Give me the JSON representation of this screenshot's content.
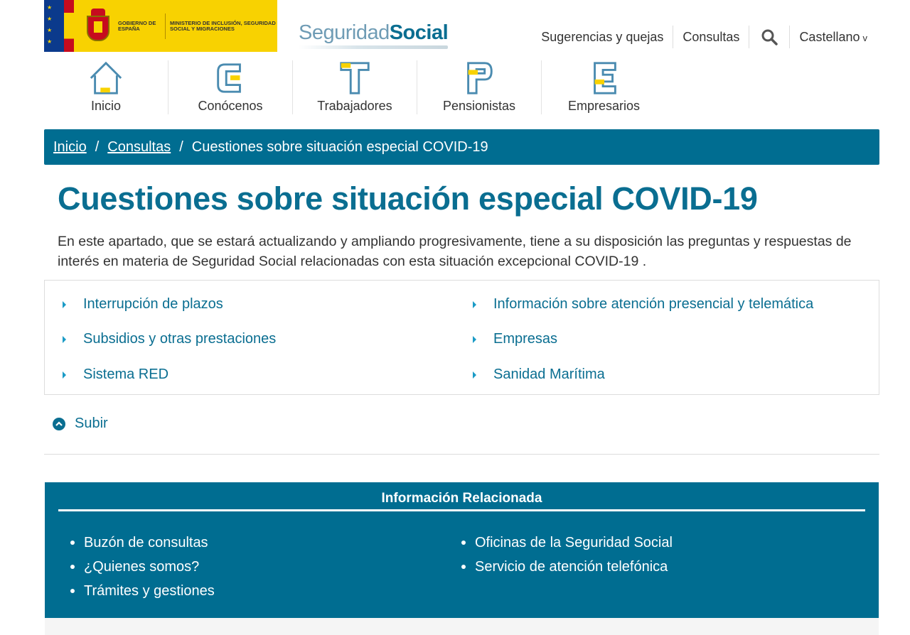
{
  "header": {
    "gov_logo_text": "GOBIERNO DE ESPAÑA",
    "ministry_text": "MINISTERIO DE INCLUSIÓN, SEGURIDAD SOCIAL Y MIGRACIONES",
    "site_logo_light": "Seguridad",
    "site_logo_bold": "Social",
    "links": {
      "suggestions": "Sugerencias y quejas",
      "consultas": "Consultas",
      "search_icon": "search-icon",
      "language": "Castellano",
      "language_caret": "v"
    }
  },
  "nav": {
    "items": [
      {
        "label": "Inicio",
        "icon": "house-icon"
      },
      {
        "label": "Conócenos",
        "icon": "letter-c-icon"
      },
      {
        "label": "Trabajadores",
        "icon": "letter-t-icon"
      },
      {
        "label": "Pensionistas",
        "icon": "letter-p-icon"
      },
      {
        "label": "Empresarios",
        "icon": "letter-e-icon"
      }
    ]
  },
  "breadcrumb": {
    "home": "Inicio",
    "sep": "/",
    "consultas": "Consultas",
    "current": "Cuestiones sobre situación especial COVID-19"
  },
  "main": {
    "title": "Cuestiones sobre situación especial COVID-19",
    "intro": "En este apartado, que se estará actualizando y ampliando progresivamente, tiene a su disposición las preguntas y respuestas de interés en materia de Seguridad Social relacionadas con esta situación excepcional COVID-19 .",
    "topics_left": [
      "Interrupción de plazos",
      "Subsidios y otras prestaciones",
      "Sistema RED"
    ],
    "topics_right": [
      "Información sobre atención presencial y telemática",
      "Empresas",
      "Sanidad Marítima"
    ],
    "back_to_top": "Subir"
  },
  "related": {
    "title": "Información Relacionada",
    "left": [
      "Buzón de consultas",
      "¿Quienes somos?",
      "Trámites y gestiones"
    ],
    "right": [
      "Oficinas de la Seguridad Social",
      "Servicio de atención telefónica"
    ]
  },
  "colors": {
    "brand_blue": "#006d91",
    "accent_yellow": "#f8d201",
    "link_blue": "#0a6e91"
  }
}
